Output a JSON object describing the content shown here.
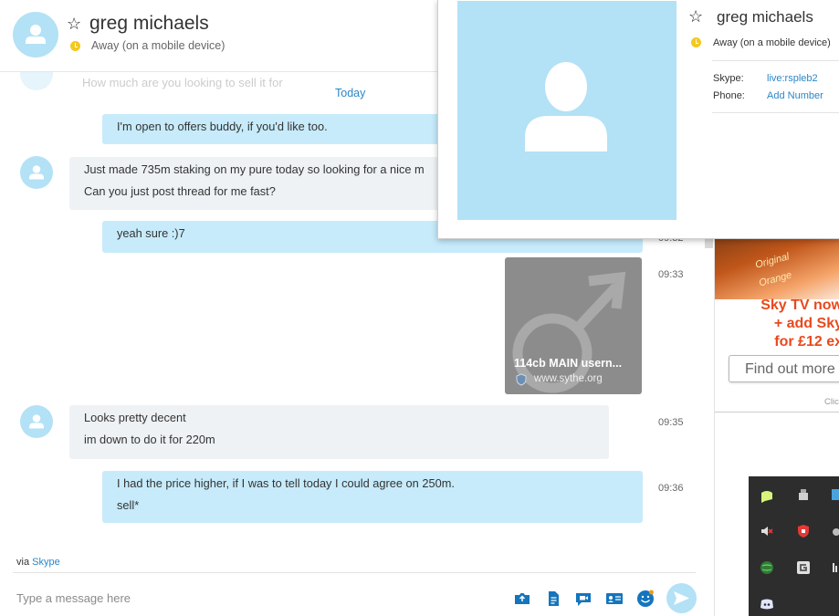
{
  "header": {
    "contact_name": "greg michaels",
    "status": "Away (on a mobile device)"
  },
  "chat": {
    "faded_text": "How much are you looking to sell it for",
    "day_separator": "Today",
    "messages": [
      {
        "direction": "outgoing",
        "lines": [
          "I'm open to offers buddy, if you'd like too."
        ],
        "time": ""
      },
      {
        "direction": "incoming",
        "lines": [
          "Just made 735m staking on my pure today so looking for a nice m",
          "Can you just post thread for me fast?"
        ],
        "time": ""
      },
      {
        "direction": "outgoing",
        "lines": [
          "yeah sure :)7"
        ],
        "time": "09:32"
      },
      {
        "direction": "outgoing",
        "type": "link",
        "title": "114cb MAIN usern...",
        "url": "www.sythe.org",
        "time": "09:33"
      },
      {
        "direction": "incoming",
        "lines": [
          "Looks pretty decent",
          "im down to do it for 220m"
        ],
        "time": "09:35"
      },
      {
        "direction": "outgoing",
        "lines": [
          "I had the price higher, if I was to tell today I could agree on 250m.",
          "sell*"
        ],
        "time": "09:36"
      }
    ]
  },
  "footer": {
    "via_prefix": "via",
    "via_link": "Skype",
    "compose_placeholder": "Type a message here"
  },
  "popup": {
    "name": "greg michaels",
    "status": "Away (on a mobile device)",
    "skype_label": "Skype:",
    "skype_value": "live:rspleb2",
    "phone_label": "Phone:",
    "phone_value": "Add Number"
  },
  "ad": {
    "sticker1": "Original",
    "sticker2": "Orange",
    "line1": "Sky TV now",
    "line2": "+ add Sky",
    "line3": "for £12 ex",
    "cta": "Find out more",
    "footer": "Clic"
  },
  "colors": {
    "accent": "#2b86c7",
    "bubble_out": "#c7ebfb",
    "bubble_in": "#eff2f5",
    "avatar": "#b3e1f6",
    "status_away": "#f4c81d",
    "ad_text": "#e8491d"
  }
}
